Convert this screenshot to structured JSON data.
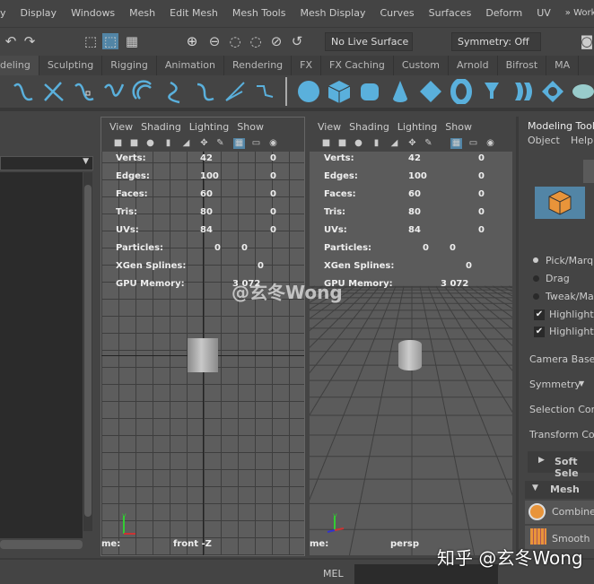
{
  "menubar": {
    "items": [
      "y",
      "Display",
      "Windows",
      "Mesh",
      "Edit Mesh",
      "Mesh Tools",
      "Mesh Display",
      "Curves",
      "Surfaces",
      "Deform",
      "UV"
    ],
    "workspace": "» Workspace"
  },
  "status": {
    "live_surface": "No Live Surface",
    "symmetry": "Symmetry: Off"
  },
  "shelf_tabs": [
    "deling",
    "Sculpting",
    "Rigging",
    "Animation",
    "Rendering",
    "FX",
    "FX Caching",
    "Custom",
    "Arnold",
    "Bifrost",
    "MA"
  ],
  "viewport_menu": [
    "View",
    "Shading",
    "Lighting",
    "Show"
  ],
  "hud": {
    "rows": [
      {
        "label": "Verts:",
        "a": "42",
        "b": "0"
      },
      {
        "label": "Edges:",
        "a": "100",
        "b": "0"
      },
      {
        "label": "Faces:",
        "a": "60",
        "b": "0"
      },
      {
        "label": "Tris:",
        "a": "80",
        "b": "0"
      },
      {
        "label": "UVs:",
        "a": "84",
        "b": "0"
      }
    ],
    "particles": {
      "label": "Particles:",
      "a": "0",
      "b": "0"
    },
    "xgen": {
      "label": "XGen Splines:",
      "a": "0"
    },
    "gpu": {
      "label": "GPU Memory:",
      "a": "3 072"
    }
  },
  "viewports": [
    {
      "name_label": "me:",
      "camera": "front -Z"
    },
    {
      "name_label": "me:",
      "camera": "persp"
    }
  ],
  "watermark_center": "@玄冬Wong",
  "watermark_corner": "知乎 @玄冬Wong",
  "right_panel": {
    "title": "Modeling Tool",
    "menu": [
      "Object",
      "Help"
    ],
    "pick": "Pick/Marque",
    "drag": "Drag",
    "tweak": "Tweak/Mar",
    "highlight1": "Highlight",
    "highlight2": "Highlight",
    "camera_based": "Camera Based",
    "symmetry": "Symmetry",
    "selection_con": "Selection Con",
    "transform_con": "Transform Con",
    "soft_select": "Soft Sele",
    "mesh": "Mesh",
    "combine": "Combine",
    "smooth": "Smooth"
  },
  "command_line": {
    "label": "MEL"
  },
  "colors": {
    "accent": "#5285a6",
    "icon_blue": "#5ab0dc",
    "cube_orange": "#e8943a"
  }
}
